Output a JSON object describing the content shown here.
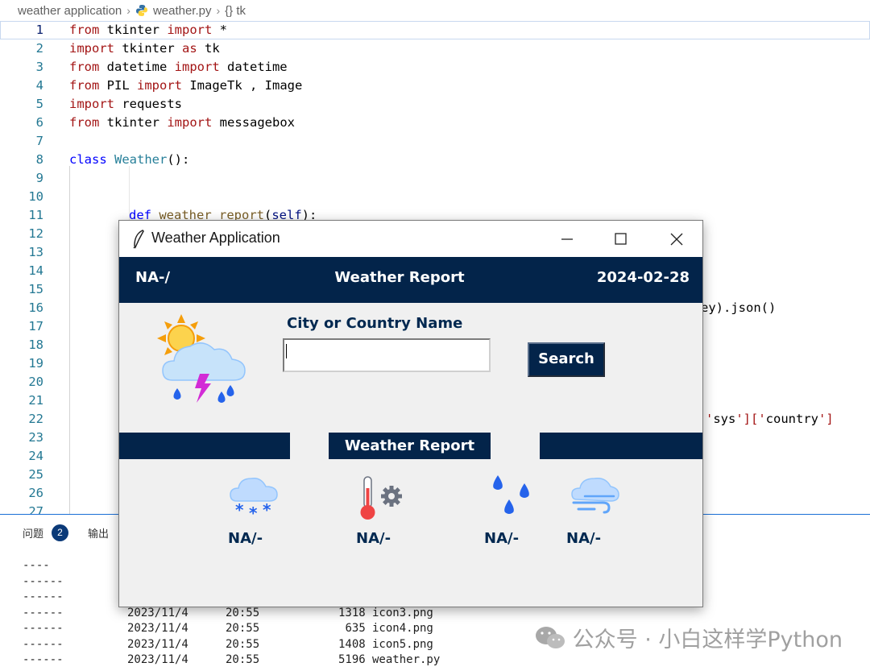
{
  "breadcrumb": {
    "folder": "weather application",
    "file": "weather.py",
    "symbol": "{} tk"
  },
  "editor": {
    "current_line": 1,
    "lines": [
      {
        "n": "1",
        "code": "from tkinter import *"
      },
      {
        "n": "2",
        "code": "import tkinter as tk"
      },
      {
        "n": "3",
        "code": "from datetime import datetime"
      },
      {
        "n": "4",
        "code": "from PIL import ImageTk , Image"
      },
      {
        "n": "5",
        "code": "import requests"
      },
      {
        "n": "6",
        "code": "from tkinter import messagebox"
      },
      {
        "n": "7",
        "code": ""
      },
      {
        "n": "8",
        "code": "class Weather():"
      },
      {
        "n": "9",
        "code": ""
      },
      {
        "n": "10",
        "code": ""
      },
      {
        "n": "11",
        "code": "        def weather_report(self):"
      },
      {
        "n": "12",
        "code": ""
      },
      {
        "n": "13",
        "code": ""
      },
      {
        "n": "14",
        "code": ""
      },
      {
        "n": "15",
        "code": ""
      },
      {
        "n": "16",
        "code": "ey).json()"
      },
      {
        "n": "17",
        "code": ""
      },
      {
        "n": "18",
        "code": ""
      },
      {
        "n": "19",
        "code": ""
      },
      {
        "n": "20",
        "code": ""
      },
      {
        "n": "21",
        "code": ""
      },
      {
        "n": "22",
        "code": "'sys']['country']"
      },
      {
        "n": "23",
        "code": ""
      },
      {
        "n": "24",
        "code": ""
      },
      {
        "n": "25",
        "code": ""
      },
      {
        "n": "26",
        "code": ""
      },
      {
        "n": "27",
        "code": ""
      }
    ]
  },
  "panel": {
    "tab_problems": "问题",
    "problems_count": "2",
    "tab_output": "输出",
    "terminal": [
      {
        "dash": "----",
        "date": "",
        "time": "",
        "size": "",
        "name": ""
      },
      {
        "dash": "------",
        "date": "",
        "time": "",
        "size": "",
        "name": ""
      },
      {
        "dash": "------",
        "date": "",
        "time": "",
        "size": "",
        "name": ""
      },
      {
        "dash": "------",
        "date": "2023/11/4",
        "time": "20:55",
        "size": "1318",
        "name": "icon3.png"
      },
      {
        "dash": "------",
        "date": "2023/11/4",
        "time": "20:55",
        "size": "635",
        "name": "icon4.png"
      },
      {
        "dash": "------",
        "date": "2023/11/4",
        "time": "20:55",
        "size": "1408",
        "name": "icon5.png"
      },
      {
        "dash": "------",
        "date": "2023/11/4",
        "time": "20:55",
        "size": "5196",
        "name": "weather.py"
      }
    ]
  },
  "watermark": "公众号 · 小白这样学Python",
  "app": {
    "window_title": "Weather Application",
    "header_left": "NA-/",
    "header_center": "Weather Report",
    "header_right": "2024-02-28",
    "city_label": "City or Country Name",
    "city_value": "",
    "search_label": "Search",
    "section_label": "Weather Report",
    "stats": [
      {
        "icon": "snow-cloud-icon",
        "value": "NA/-"
      },
      {
        "icon": "thermometer-gear-icon",
        "value": "NA/-"
      },
      {
        "icon": "water-drops-icon",
        "value": "NA/-"
      },
      {
        "icon": "wind-cloud-icon",
        "value": "NA/-"
      }
    ],
    "colors": {
      "navy": "#03244a",
      "label": "#002850",
      "window_bg": "#f0f0f0"
    }
  }
}
